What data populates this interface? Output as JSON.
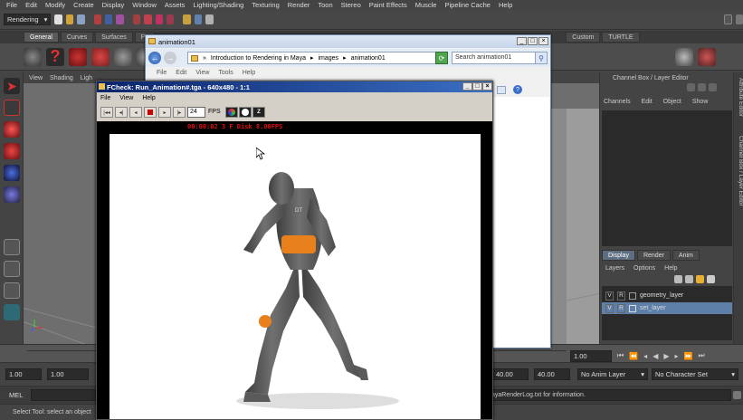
{
  "menubar": {
    "items": [
      "File",
      "Edit",
      "Modify",
      "Create",
      "Display",
      "Window",
      "Assets",
      "Lighting/Shading",
      "Texturing",
      "Render",
      "Toon",
      "Stereo",
      "Paint Effects",
      "Muscle",
      "Pipeline Cache",
      "Help"
    ]
  },
  "statusline": {
    "menuset": "Rendering"
  },
  "shelf": {
    "tabs": [
      "General",
      "Curves",
      "Surfaces",
      "Pu"
    ],
    "right_tabs": [
      "Custom",
      "TURTLE"
    ]
  },
  "viewport": {
    "menu": [
      "View",
      "Shading",
      "Ligh"
    ]
  },
  "explorer": {
    "title": "animation01",
    "breadcrumb": [
      "Introduction to Rendering in Maya",
      "images",
      "animation01"
    ],
    "search_placeholder": "Search animation01",
    "menu": [
      "File",
      "Edit",
      "View",
      "Tools",
      "Help"
    ]
  },
  "fcheck": {
    "title": "FCheck: Run_Animation#.tga - 640x480 - 1:1",
    "menu": [
      "File",
      "View",
      "Help"
    ],
    "fps_value": "24",
    "fps_label": "FPS",
    "status": "00:00:02  3 F Disk  8.00FPS",
    "figure_chest_label": "DT"
  },
  "channelbox": {
    "title": "Channel Box / Layer Editor",
    "menu": [
      "Channels",
      "Edit",
      "Object",
      "Show"
    ],
    "layer_tabs": [
      "Display",
      "Render",
      "Anim"
    ],
    "layer_menu": [
      "Layers",
      "Options",
      "Help"
    ],
    "layers": [
      {
        "v": "V",
        "r": "R",
        "name": "geometry_layer",
        "selected": false
      },
      {
        "v": "V",
        "r": "R",
        "name": "set_layer",
        "selected": true
      }
    ],
    "side_tabs": [
      "Attribute Editor",
      "Channel Box / Layer Editor"
    ]
  },
  "range": {
    "start": "1.00",
    "start2": "1.00",
    "end": "40.00",
    "end2": "40.00",
    "current": "1.00",
    "anim_layer": "No Anim Layer",
    "char_set": "No Character Set"
  },
  "cmdline": {
    "label": "MEL",
    "output": "ayaRenderLog.txt for information."
  },
  "helpline": {
    "text": "Select Tool: select an object"
  },
  "colors": {
    "maya_bg": "#444444",
    "fcheck_title": "#0a246a",
    "selected_layer": "#5d7fa8",
    "status_red": "#e01010",
    "figure_gray": "#5a5a5a",
    "figure_orange": "#e8801c"
  }
}
